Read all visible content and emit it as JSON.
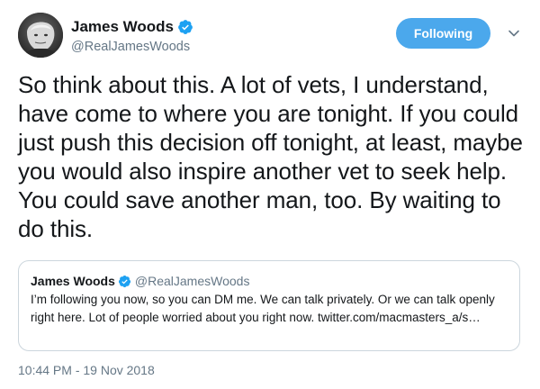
{
  "author": {
    "display_name": "James Woods",
    "handle": "@RealJamesWoods"
  },
  "actions": {
    "follow_label": "Following"
  },
  "tweet": {
    "text": "So think about this. A lot of vets, I understand, have come to where you are tonight. If you could just push this decision off tonight, at least, maybe you would also inspire another vet to seek help. You could save another man, too. By waiting to do this.",
    "timestamp": "10:44 PM - 19 Nov 2018"
  },
  "quoted_tweet": {
    "display_name": "James Woods",
    "handle": "@RealJamesWoods",
    "text": "I’m following you now, so you can DM me. We can talk privately. Or we can talk openly right here. Lot of people worried about you right now. twitter.com/macmasters_a/s…"
  },
  "colors": {
    "accent": "#4ba8ec",
    "verified": "#1da1f2",
    "muted_text": "#657786",
    "border": "#ccd6dd"
  },
  "icons": {
    "verified": "verified-badge-icon",
    "menu": "chevron-down-icon"
  }
}
